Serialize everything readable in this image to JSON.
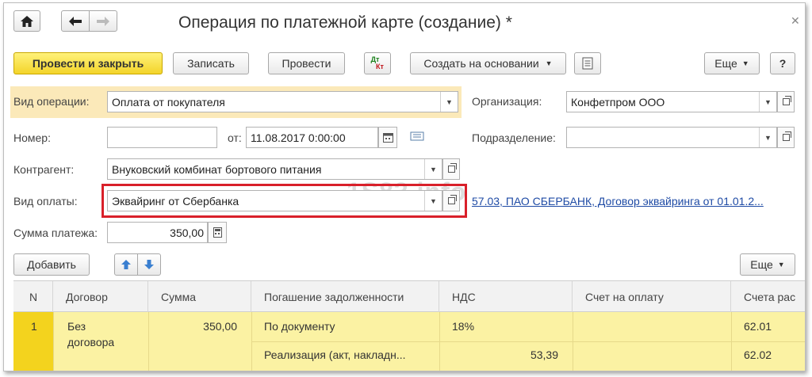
{
  "window": {
    "title": "Операция по платежной карте (создание) *"
  },
  "nav": {
    "home": "home",
    "back": "arrow-left",
    "forward": "arrow-right"
  },
  "toolbar": {
    "post_close": "Провести и закрыть",
    "save": "Записать",
    "post": "Провести",
    "dtkt_top": "Дт",
    "dtkt_bottom": "Кт",
    "create_based": "Создать на основании",
    "more": "Еще",
    "help": "?"
  },
  "form": {
    "op_type_label": "Вид операции:",
    "op_type_value": "Оплата от покупателя",
    "org_label": "Организация:",
    "org_value": "Конфетпром ООО",
    "number_label": "Номер:",
    "number_value": "",
    "from_label": "от:",
    "date_value": "11.08.2017  0:00:00",
    "division_label": "Подразделение:",
    "division_value": "",
    "counterparty_label": "Контрагент:",
    "counterparty_value": "Внуковский комбинат бортового питания",
    "pay_type_label": "Вид оплаты:",
    "pay_type_value": "Эквайринг от Сбербанка",
    "pay_type_link": "57.03, ПАО СБЕРБАНК, Договор эквайринга от 01.01.2...",
    "amount_label": "Сумма платежа:",
    "amount_value": "350,00",
    "watermark": "1S83.info"
  },
  "table_toolbar": {
    "add": "Добавить",
    "more": "Еще"
  },
  "table": {
    "columns": [
      "N",
      "Договор",
      "Сумма",
      "Погашение задолженности",
      "НДС",
      "Счет на оплату",
      "Счета рас"
    ],
    "rows": [
      {
        "n": "1",
        "contract_line1": "Без",
        "contract_line2": "договора",
        "amount": "350,00",
        "repayment": "По документу",
        "repayment_doc": "Реализация (акт, накладн...",
        "vat_rate": "18%",
        "vat_amount": "53,39",
        "invoice": "",
        "account1": "62.01",
        "account2": "62.02"
      }
    ]
  },
  "colors": {
    "primary_button": "#f3d42a",
    "highlight_frame": "#d9202a",
    "selected_row": "#fbf2a3",
    "link": "#1f4ba5",
    "op_type_bg": "#fbe9b9"
  }
}
